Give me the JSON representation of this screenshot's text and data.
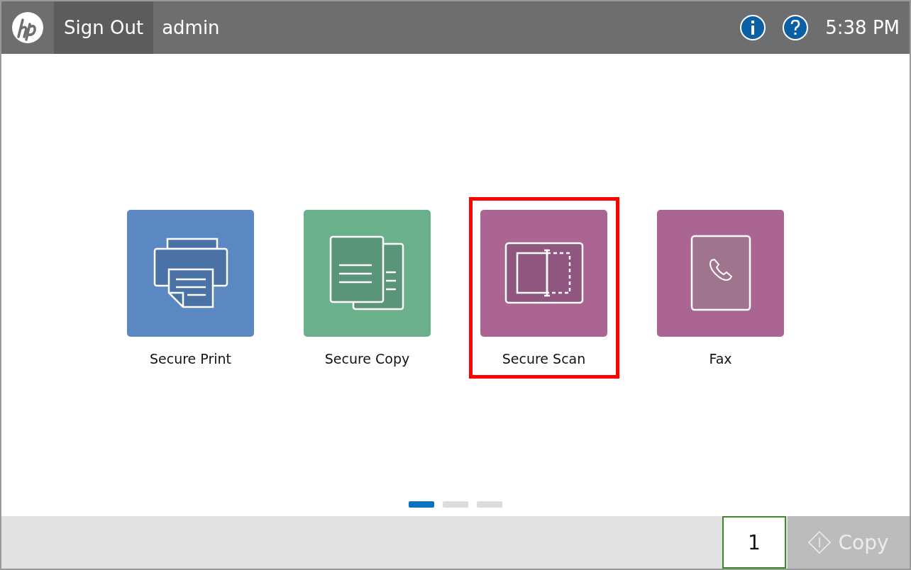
{
  "header": {
    "sign_out": "Sign Out",
    "user": "admin",
    "time": "5:38 PM"
  },
  "apps": [
    {
      "label": "Secure Print",
      "kind": "print",
      "color": "#5b88c2",
      "selected": false
    },
    {
      "label": "Secure Copy",
      "kind": "copy",
      "color": "#6ab08b",
      "selected": false
    },
    {
      "label": "Secure Scan",
      "kind": "scan",
      "color": "#ab6592",
      "selected": true
    },
    {
      "label": "Fax",
      "kind": "fax",
      "color": "#ab6592",
      "selected": false
    }
  ],
  "pager": [
    {
      "selected": true
    },
    {
      "selected": false
    },
    {
      "selected": false
    }
  ],
  "footer": {
    "copies": "1",
    "copy_button": {
      "label": "Copy",
      "disabled": true
    }
  }
}
